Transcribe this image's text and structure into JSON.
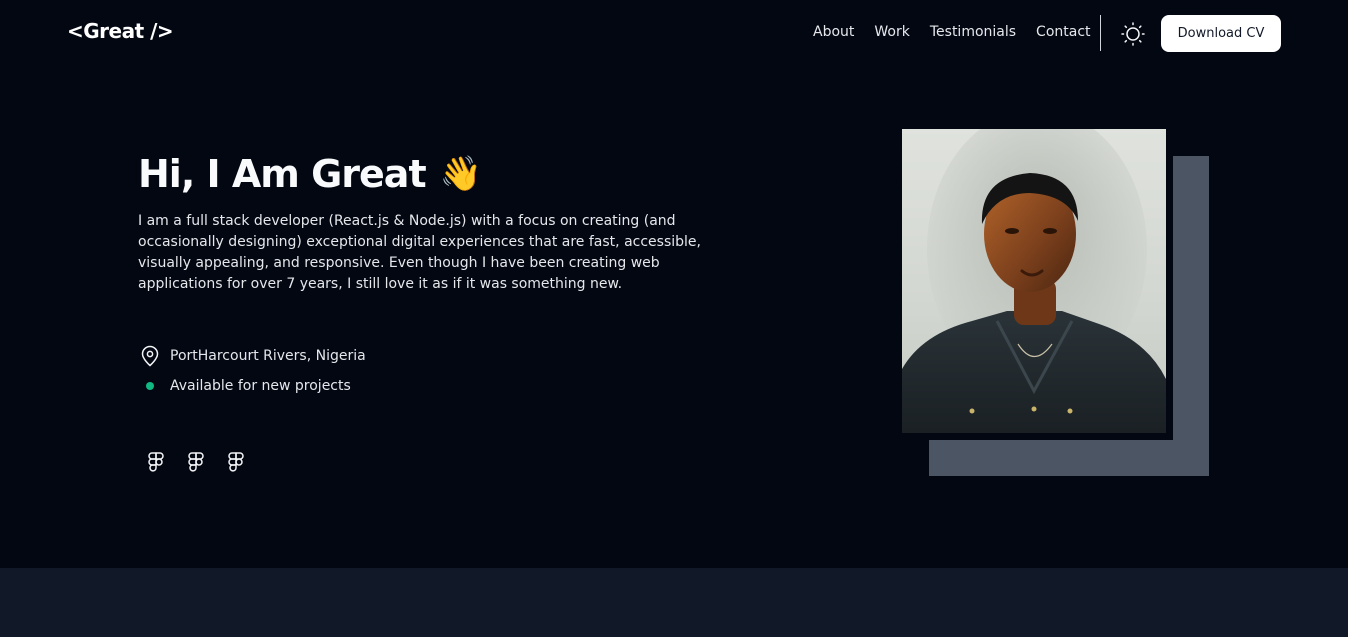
{
  "nav": {
    "logo": "<Great />",
    "links": [
      "About",
      "Work",
      "Testimonials",
      "Contact"
    ],
    "download_cv": "Download CV"
  },
  "hero": {
    "title": "Hi, I Am Great",
    "wave_emoji": "👋",
    "bio": "I am a full stack developer (React.js & Node.js) with a focus on creating (and occasionally designing) exceptional digital experiences that are fast, accessible, visually appealing, and responsive. Even though I have been creating web applications for over 7 years, I still love it as if it was something new.",
    "location": "PortHarcourt Rivers, Nigeria",
    "availability": "Available for new projects"
  },
  "socials": [
    "figma-icon",
    "figma-icon",
    "figma-icon"
  ],
  "colors": {
    "background": "#030712",
    "footer_band": "#111827",
    "photo_backdrop": "#4b5563",
    "available_dot": "#10b981",
    "button_bg": "#ffffff"
  }
}
